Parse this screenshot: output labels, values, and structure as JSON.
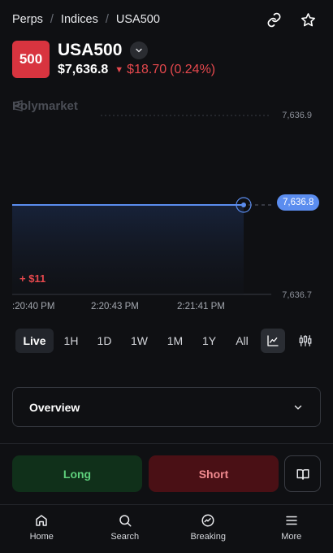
{
  "breadcrumb": [
    "Perps",
    "Indices",
    "USA500"
  ],
  "header": {
    "badge": "500",
    "title": "USA500",
    "price": "$7,636.8",
    "change_arrow": "▼",
    "change_amount": "$18.70",
    "change_pct": "(0.24%)"
  },
  "chart": {
    "watermark": "Polymarket",
    "y_top": "7,636.9",
    "y_bottom": "7,636.7",
    "current_price": "7,636.8",
    "pnl": "+ $11",
    "x_labels": [
      ":20:40 PM",
      "2:20:43 PM",
      "2:21:41 PM"
    ]
  },
  "chart_data": {
    "type": "line",
    "ylim": [
      7636.7,
      7636.9
    ],
    "y_ticks": [
      "7,636.9",
      "7,636.7"
    ],
    "x_ticks": [
      ":20:40 PM",
      "2:20:43 PM",
      "2:21:41 PM"
    ],
    "series": [
      {
        "values": [
          7636.8,
          7636.8,
          7636.8,
          7636.8
        ]
      }
    ],
    "grid": true
  },
  "timeframes": {
    "items": [
      "Live",
      "1H",
      "1D",
      "1W",
      "1M",
      "1Y",
      "All"
    ],
    "active": "Live"
  },
  "overview": {
    "label": "Overview"
  },
  "actions": {
    "long": "Long",
    "short": "Short"
  },
  "nav": {
    "items": [
      {
        "label": "Home",
        "icon": "home-icon"
      },
      {
        "label": "Search",
        "icon": "search-icon"
      },
      {
        "label": "Breaking",
        "icon": "breaking-icon"
      },
      {
        "label": "More",
        "icon": "menu-icon"
      }
    ]
  },
  "colors": {
    "accent": "#5b8def",
    "down": "#e5484d",
    "up": "#5ed07c",
    "background": "#0f1013"
  }
}
